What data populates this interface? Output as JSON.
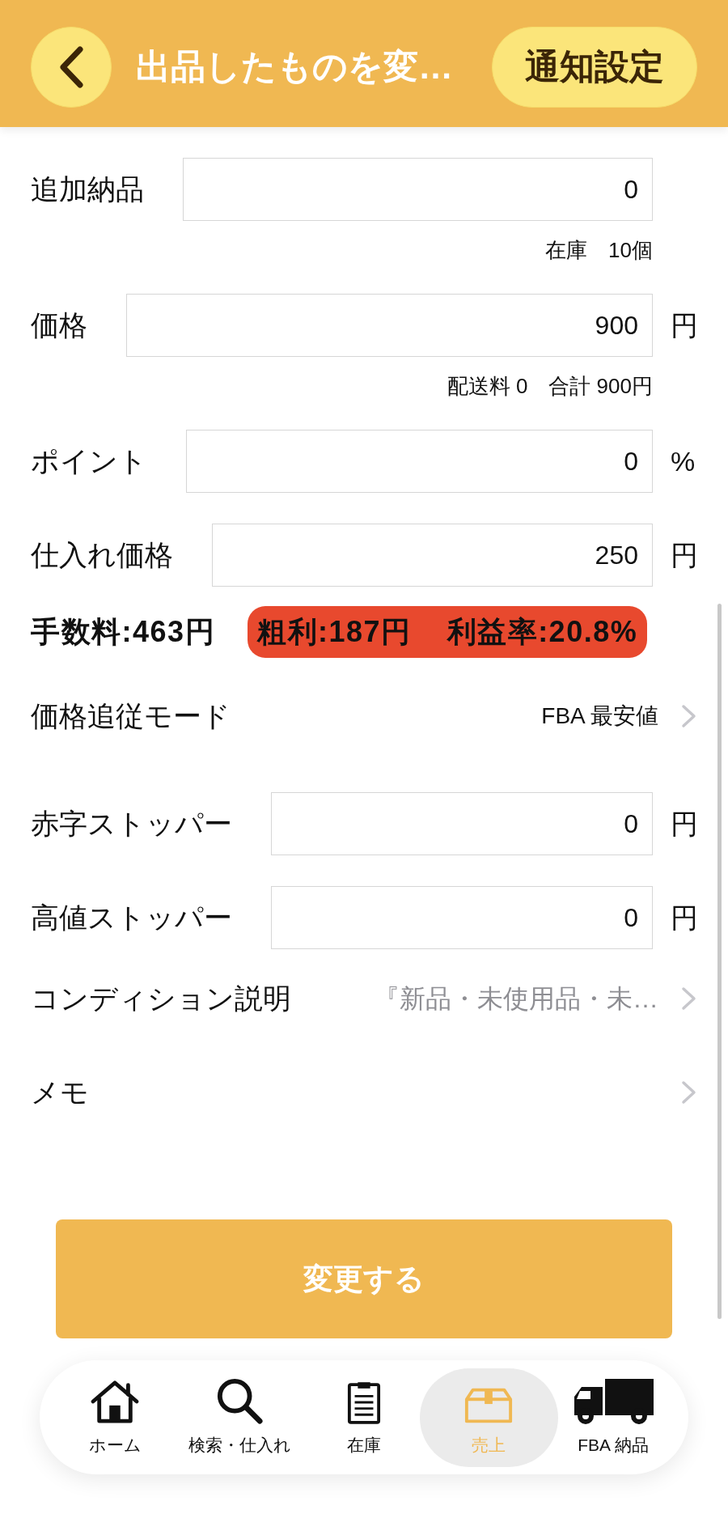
{
  "header": {
    "title": "出品したものを変…",
    "action": "通知設定"
  },
  "rows": [
    {
      "kind": "input",
      "label": "追加納品",
      "value": "0"
    },
    {
      "kind": "note",
      "text": "在庫　10個"
    },
    {
      "kind": "input",
      "label": "価格",
      "value": "900",
      "unit": "円"
    },
    {
      "kind": "note",
      "text": "配送料 0　合計 900円"
    },
    {
      "kind": "input",
      "label": "ポイント",
      "value": "0",
      "unit": "%"
    },
    {
      "kind": "input",
      "label": "仕入れ価格",
      "value": "250",
      "unit": "円"
    },
    {
      "kind": "summary",
      "items": [
        "手数料:463円"
      ],
      "marked_items": [
        "粗利:187円",
        "利益率:20.8%"
      ]
    },
    {
      "kind": "link",
      "label": "価格追従モード",
      "value": "FBA 最安値",
      "dimmed": false
    },
    {
      "kind": "input",
      "label": "赤字ストッパー",
      "value": "0",
      "unit": "円"
    },
    {
      "kind": "input",
      "label": "高値ストッパー",
      "value": "0",
      "unit": "円"
    },
    {
      "kind": "link",
      "label": "コンディション説明",
      "value": "『新品・未使用品・未…",
      "dimmed": true
    },
    {
      "kind": "link",
      "label": "メモ"
    }
  ],
  "submit_button": "変更する",
  "nav": [
    {
      "label": "ホーム",
      "selected": false
    },
    {
      "label": "検索・仕入れ",
      "selected": false
    },
    {
      "label": "在庫",
      "selected": false
    },
    {
      "label": "売上",
      "selected": true
    },
    {
      "label": "FBA 納品",
      "selected": false
    }
  ]
}
